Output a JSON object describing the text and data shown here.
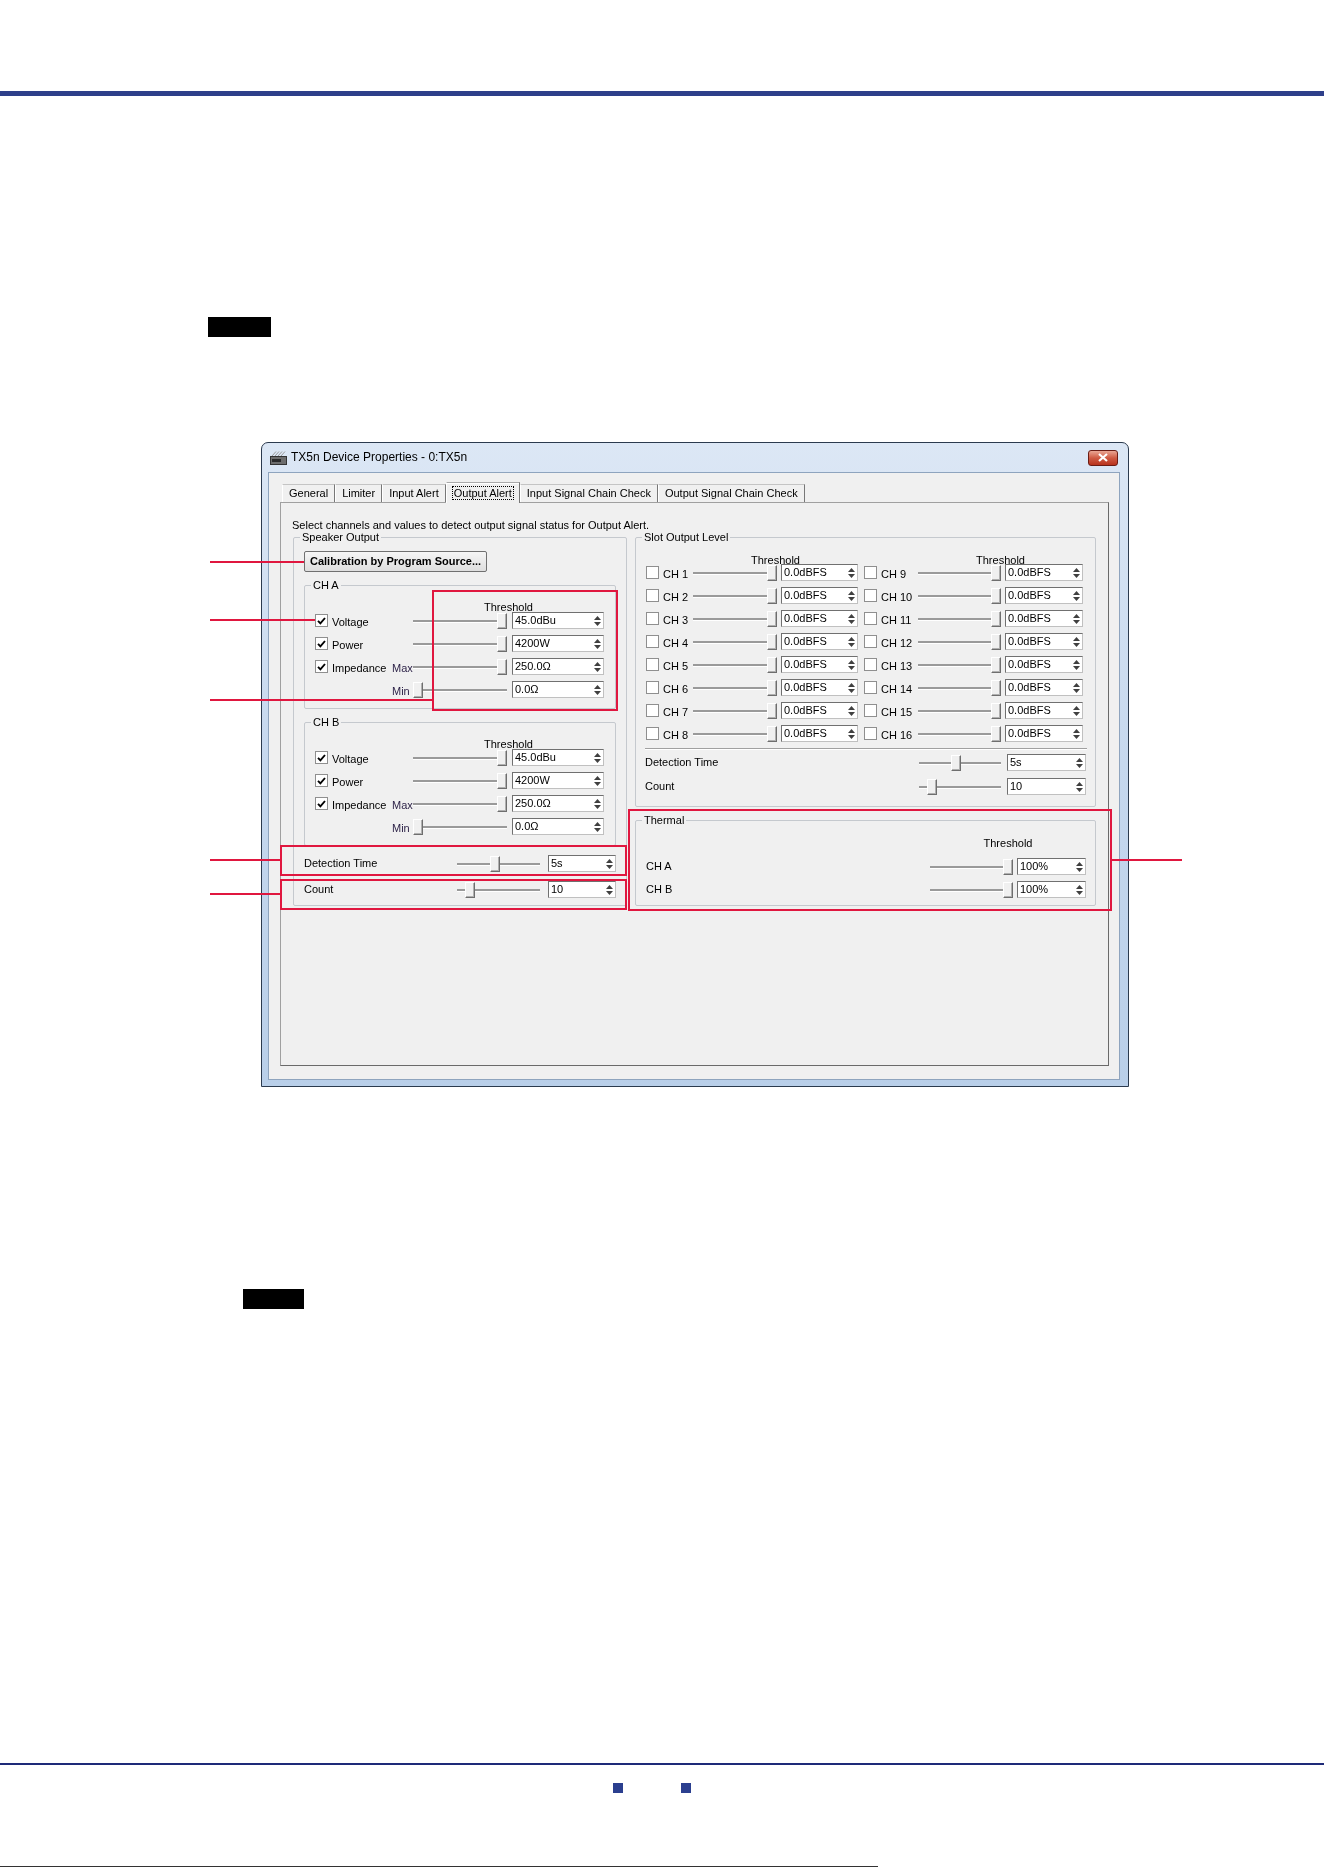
{
  "window": {
    "title": "TX5n Device Properties - 0:TX5n"
  },
  "tabs": [
    {
      "label": "General",
      "selected": false
    },
    {
      "label": "Limiter",
      "selected": false
    },
    {
      "label": "Input Alert",
      "selected": false
    },
    {
      "label": "Output Alert",
      "selected": true
    },
    {
      "label": "Input Signal Chain Check",
      "selected": false
    },
    {
      "label": "Output Signal Chain Check",
      "selected": false
    }
  ],
  "description": "Select channels and values to detect output signal status for Output Alert.",
  "speaker_output": {
    "title": "Speaker Output",
    "calibration_button": {
      "label": "Calibration by Program Source...",
      "callout": true
    },
    "channels": [
      {
        "title": "CH A",
        "threshold_header": "Threshold",
        "highlighted": true,
        "rows": [
          {
            "kind": "check",
            "label": "Voltage",
            "checked": true,
            "callout": true,
            "level": 1,
            "value": "45.0dBu"
          },
          {
            "kind": "check",
            "label": "Power",
            "checked": true,
            "callout": false,
            "level": 1,
            "value": "4200W"
          },
          {
            "kind": "check",
            "label": "Impedance",
            "sublabel": "Max",
            "checked": true,
            "callout": false,
            "level": 1,
            "value": "250.0Ω"
          },
          {
            "kind": "plain",
            "sublabel": "Min",
            "callout": false,
            "level": 0,
            "value": "0.0Ω"
          }
        ]
      },
      {
        "title": "CH B",
        "threshold_header": "Threshold",
        "highlighted": false,
        "rows": [
          {
            "kind": "check",
            "label": "Voltage",
            "checked": true,
            "callout": false,
            "level": 1,
            "value": "45.0dBu"
          },
          {
            "kind": "check",
            "label": "Power",
            "checked": true,
            "callout": false,
            "level": 1,
            "value": "4200W"
          },
          {
            "kind": "check",
            "label": "Impedance",
            "sublabel": "Max",
            "checked": true,
            "callout": false,
            "level": 1,
            "value": "250.0Ω"
          },
          {
            "kind": "plain",
            "sublabel": "Min",
            "callout": false,
            "level": 0,
            "value": "0.0Ω"
          }
        ]
      }
    ],
    "detection_time": {
      "label": "Detection Time",
      "highlighted": true,
      "level": 0.45,
      "value": "5s"
    },
    "count": {
      "label": "Count",
      "highlighted": true,
      "level": 0.11,
      "value": "10"
    }
  },
  "slot_output_level": {
    "title": "Slot Output Level",
    "threshold_headers": [
      "Threshold",
      "Threshold"
    ],
    "channels": [
      {
        "label": "CH 1",
        "checked": false,
        "level": 1,
        "value": "0.0dBFS"
      },
      {
        "label": "CH 2",
        "checked": false,
        "level": 1,
        "value": "0.0dBFS"
      },
      {
        "label": "CH 3",
        "checked": false,
        "level": 1,
        "value": "0.0dBFS"
      },
      {
        "label": "CH 4",
        "checked": false,
        "level": 1,
        "value": "0.0dBFS"
      },
      {
        "label": "CH 5",
        "checked": false,
        "level": 1,
        "value": "0.0dBFS"
      },
      {
        "label": "CH 6",
        "checked": false,
        "level": 1,
        "value": "0.0dBFS"
      },
      {
        "label": "CH 7",
        "checked": false,
        "level": 1,
        "value": "0.0dBFS"
      },
      {
        "label": "CH 8",
        "checked": false,
        "level": 1,
        "value": "0.0dBFS"
      },
      {
        "label": "CH 9",
        "checked": false,
        "level": 1,
        "value": "0.0dBFS"
      },
      {
        "label": "CH 10",
        "checked": false,
        "level": 1,
        "value": "0.0dBFS"
      },
      {
        "label": "CH 11",
        "checked": false,
        "level": 1,
        "value": "0.0dBFS"
      },
      {
        "label": "CH 12",
        "checked": false,
        "level": 1,
        "value": "0.0dBFS"
      },
      {
        "label": "CH 13",
        "checked": false,
        "level": 1,
        "value": "0.0dBFS"
      },
      {
        "label": "CH 14",
        "checked": false,
        "level": 1,
        "value": "0.0dBFS"
      },
      {
        "label": "CH 15",
        "checked": false,
        "level": 1,
        "value": "0.0dBFS"
      },
      {
        "label": "CH 16",
        "checked": false,
        "level": 1,
        "value": "0.0dBFS"
      }
    ],
    "detection_time": {
      "label": "Detection Time",
      "highlighted": false,
      "level": 0.45,
      "value": "5s"
    },
    "count": {
      "label": "Count",
      "highlighted": false,
      "level": 0.11,
      "value": "10"
    }
  },
  "thermal": {
    "title": "Thermal",
    "threshold_header": "Threshold",
    "highlighted": true,
    "channels": [
      {
        "label": "CH A",
        "level": 1,
        "value": "100%"
      },
      {
        "label": "CH B",
        "level": 1,
        "value": "100%"
      }
    ]
  }
}
